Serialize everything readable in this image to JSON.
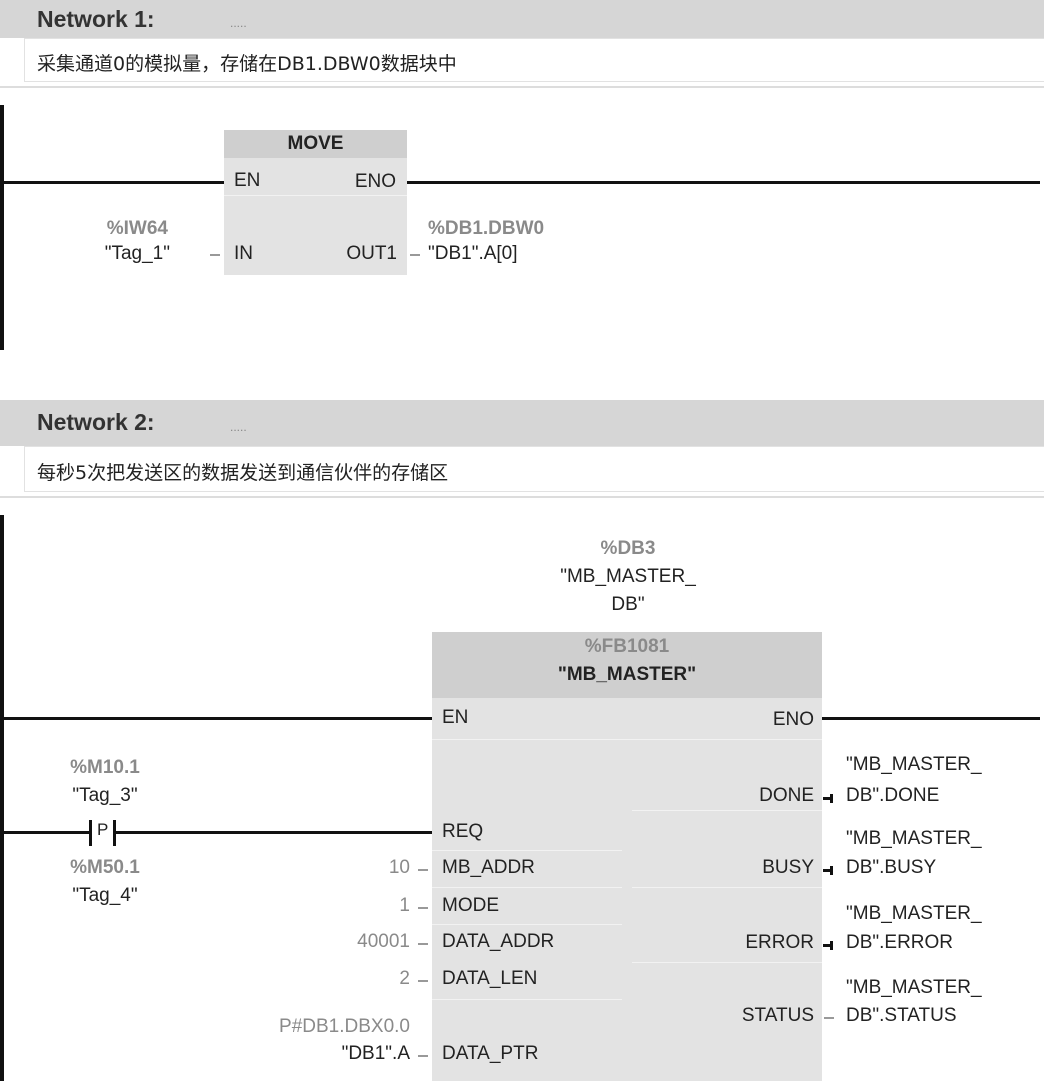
{
  "network1": {
    "title": "Network 1:",
    "dots": ".....",
    "comment": "采集通道0的模拟量，存储在DB1.DBW0数据块中",
    "block": {
      "name": "MOVE",
      "en": "EN",
      "eno": "ENO",
      "in": "IN",
      "out": "OUT1",
      "in_addr": "%IW64",
      "in_tag": "\"Tag_1\"",
      "out_addr": "%DB1.DBW0",
      "out_tag": "\"DB1\".A[0]"
    }
  },
  "network2": {
    "title": "Network 2:",
    "dots": ".....",
    "comment": "每秒5次把发送区的数据发送到通信伙伴的存储区",
    "instance": {
      "addr": "%DB3",
      "line1": "\"MB_MASTER_",
      "line2": "DB\""
    },
    "block": {
      "fb": "%FB1081",
      "name": "\"MB_MASTER\"",
      "en": "EN",
      "eno": "ENO",
      "inputs": {
        "req": "REQ",
        "mb_addr": "MB_ADDR",
        "mode": "MODE",
        "data_addr": "DATA_ADDR",
        "data_len": "DATA_LEN",
        "data_ptr": "DATA_PTR"
      },
      "outputs": {
        "done": "DONE",
        "busy": "BUSY",
        "error": "ERROR",
        "status": "STATUS"
      }
    },
    "contact": {
      "label": "P",
      "addr": "%M10.1",
      "tag": "\"Tag_3\"",
      "edge_addr": "%M50.1",
      "edge_tag": "\"Tag_4\""
    },
    "values": {
      "mb_addr": "10",
      "mode": "1",
      "data_addr": "40001",
      "data_len": "2",
      "data_ptr_addr": "P#DB1.DBX0.0",
      "data_ptr": "\"DB1\".A"
    },
    "out_tags": {
      "prefix": "\"MB_MASTER_",
      "done": "DB\".DONE",
      "busy": "DB\".BUSY",
      "error": "DB\".ERROR",
      "status": "DB\".STATUS"
    }
  }
}
